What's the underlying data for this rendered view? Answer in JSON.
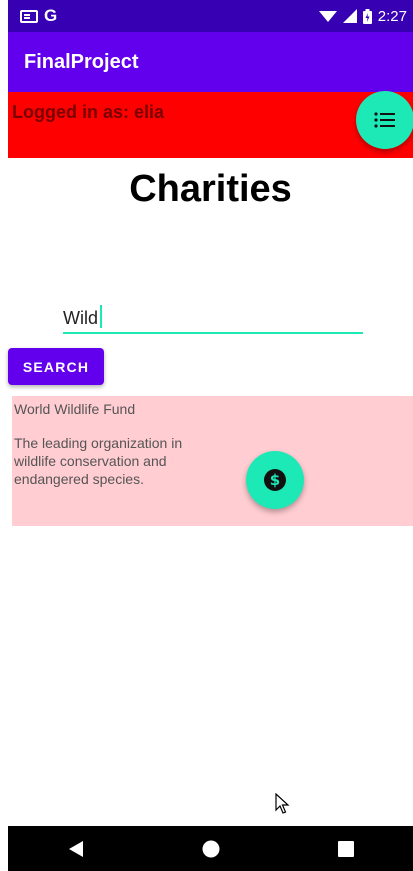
{
  "status_bar": {
    "carrier": "G",
    "time": "2:27"
  },
  "app_bar": {
    "title": "FinalProject"
  },
  "banner": {
    "logged_in_text": "Logged in as: elia",
    "color": "#ff0000"
  },
  "main": {
    "heading": "Charities",
    "search_value": "Wild",
    "search_button_label": "SEARCH"
  },
  "results": [
    {
      "name": "World Wildlife Fund",
      "description": "The leading organization in wildlife conservation and endangered species."
    }
  ],
  "icons": {
    "list_fab": "list-icon",
    "donate_fab": "dollar-icon",
    "nav": [
      "back-icon",
      "home-icon",
      "recents-icon"
    ]
  },
  "colors": {
    "primary": "#6200ee",
    "primary_dark": "#3700b3",
    "accent": "#1de9b6",
    "card": "#ffcdd2"
  }
}
